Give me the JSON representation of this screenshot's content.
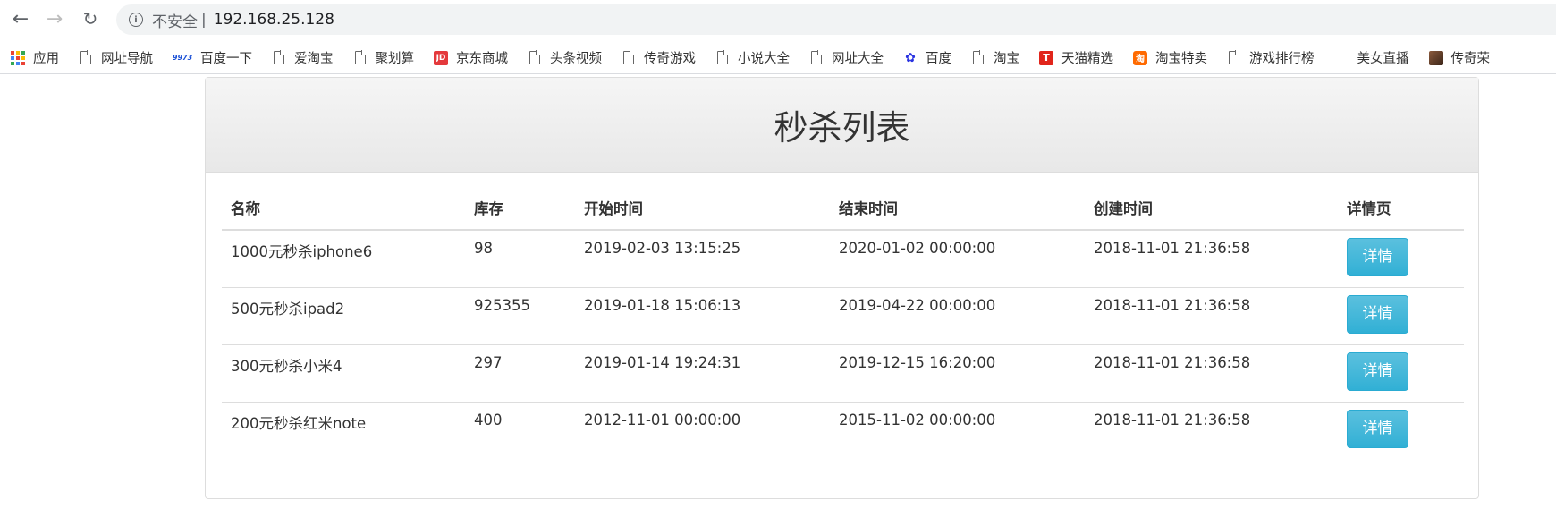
{
  "browser": {
    "insecure_label": "不安全",
    "separator": "|",
    "url": "192.168.25.128"
  },
  "bookmarks": [
    {
      "label": "应用",
      "icon": "apps-icon"
    },
    {
      "label": "网址导航",
      "icon": "file-icon"
    },
    {
      "label": "百度一下",
      "icon": "9973-icon"
    },
    {
      "label": "爱淘宝",
      "icon": "file-icon"
    },
    {
      "label": "聚划算",
      "icon": "file-icon"
    },
    {
      "label": "京东商城",
      "icon": "jd-icon"
    },
    {
      "label": "头条视频",
      "icon": "file-icon"
    },
    {
      "label": "传奇游戏",
      "icon": "file-icon"
    },
    {
      "label": "小说大全",
      "icon": "file-icon"
    },
    {
      "label": "网址大全",
      "icon": "file-icon"
    },
    {
      "label": "百度",
      "icon": "baidu-paw-icon"
    },
    {
      "label": "淘宝",
      "icon": "file-icon"
    },
    {
      "label": "天猫精选",
      "icon": "tmall-icon"
    },
    {
      "label": "淘宝特卖",
      "icon": "taobao-icon"
    },
    {
      "label": "游戏排行榜",
      "icon": "file-icon"
    },
    {
      "label": "美女直播",
      "icon": "none"
    },
    {
      "label": "传奇荣",
      "icon": "avatar-icon"
    }
  ],
  "icon_text": {
    "n9973": "9973",
    "jd": "JD",
    "tmall": "T",
    "taobao": "淘",
    "baidu": "✿"
  },
  "page": {
    "title": "秒杀列表",
    "columns": {
      "name": "名称",
      "stock": "库存",
      "start": "开始时间",
      "end": "结束时间",
      "created": "创建时间",
      "detail": "详情页"
    },
    "detail_button_label": "详情",
    "rows": [
      {
        "name": "1000元秒杀iphone6",
        "stock": "98",
        "start": "2019-02-03 13:15:25",
        "end": "2020-01-02 00:00:00",
        "created": "2018-11-01 21:36:58"
      },
      {
        "name": "500元秒杀ipad2",
        "stock": "925355",
        "start": "2019-01-18 15:06:13",
        "end": "2019-04-22 00:00:00",
        "created": "2018-11-01 21:36:58"
      },
      {
        "name": "300元秒杀小米4",
        "stock": "297",
        "start": "2019-01-14 19:24:31",
        "end": "2019-12-15 16:20:00",
        "created": "2018-11-01 21:36:58"
      },
      {
        "name": "200元秒杀红米note",
        "stock": "400",
        "start": "2012-11-01 00:00:00",
        "end": "2015-11-02 00:00:00",
        "created": "2018-11-01 21:36:58"
      }
    ]
  },
  "colors": {
    "button_bg": "#31b0d5",
    "heading_bg": "#f5f5f5",
    "border": "#dddddd"
  }
}
